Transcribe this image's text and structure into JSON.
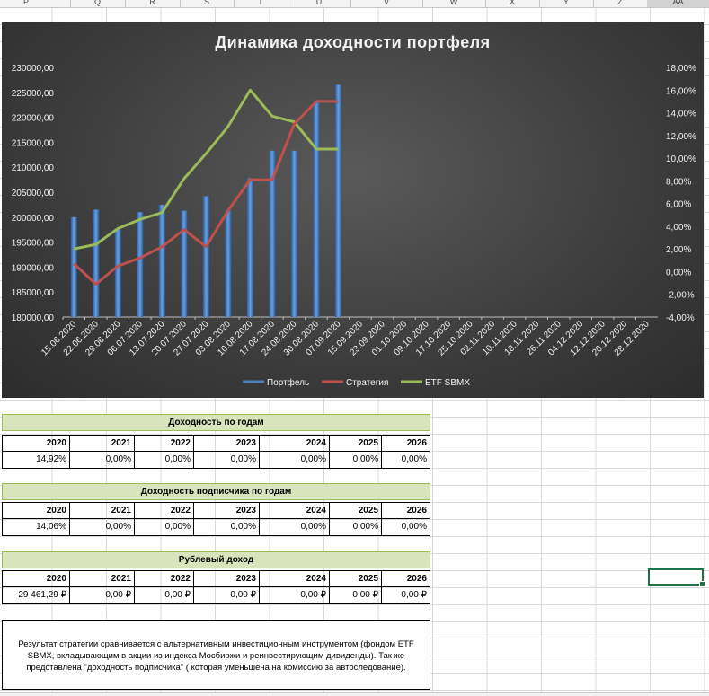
{
  "columns": [
    "P",
    "Q",
    "R",
    "S",
    "T",
    "U",
    "V",
    "W",
    "X",
    "Y",
    "Z",
    "AA"
  ],
  "chart_data": {
    "type": "bar",
    "title": "Динамика доходности портфеля",
    "categories": [
      "15.06.2020",
      "22.06.2020",
      "29.06.2020",
      "06.07.2020",
      "13.07.2020",
      "20.07.2020",
      "27.07.2020",
      "03.08.2020",
      "10.08.2020",
      "17.08.2020",
      "24.08.2020",
      "30.08.2020",
      "07.09.2020",
      "15.09.2020",
      "23.09.2020",
      "01.10.2020",
      "09.10.2020",
      "17.10.2020",
      "25.10.2020",
      "02.11.2020",
      "10.11.2020",
      "18.11.2020",
      "26.11.2020",
      "04.12.2020",
      "12.12.2020",
      "20.12.2020",
      "28.12.2020"
    ],
    "y_left_ticks": [
      "180000,00",
      "185000,00",
      "190000,00",
      "195000,00",
      "200000,00",
      "205000,00",
      "210000,00",
      "215000,00",
      "220000,00",
      "225000,00",
      "230000,00"
    ],
    "y_right_ticks": [
      "-4,00%",
      "-2,00%",
      "0,00%",
      "2,00%",
      "4,00%",
      "6,00%",
      "8,00%",
      "10,00%",
      "12,00%",
      "14,00%",
      "16,00%",
      "18,00%"
    ],
    "ylim_left": [
      180000,
      230000
    ],
    "ylim_right": [
      -4,
      18
    ],
    "series": [
      {
        "name": "Портфель",
        "type": "bar",
        "axis": "left",
        "color": "#4f81bd",
        "values": [
          200000,
          201500,
          197500,
          201000,
          202500,
          201300,
          204200,
          201300,
          207800,
          213300,
          213300,
          223000,
          226500
        ]
      },
      {
        "name": "Стратегия",
        "type": "line",
        "axis": "right",
        "color": "#c0504d",
        "values": [
          0.7,
          -1.1,
          0.5,
          1.2,
          2.2,
          3.7,
          2.2,
          5.4,
          8.1,
          8.1,
          13.0,
          15.0,
          15.0
        ]
      },
      {
        "name": "ETF SBMX",
        "type": "line",
        "axis": "right",
        "color": "#9bbb59",
        "values": [
          2.0,
          2.4,
          3.8,
          4.6,
          5.2,
          8.2,
          10.4,
          12.8,
          16.0,
          13.7,
          13.2,
          10.8,
          10.8
        ]
      }
    ],
    "legend_position": "bottom",
    "grid": false
  },
  "tables": [
    {
      "title": "Доходность по годам",
      "years": [
        "2020",
        "2021",
        "2022",
        "2023",
        "2024",
        "2025",
        "2026"
      ],
      "values": [
        "14,92%",
        "0,00%",
        "0,00%",
        "0,00%",
        "0,00%",
        "0,00%",
        "0,00%"
      ]
    },
    {
      "title": "Доходность подписчика по годам",
      "years": [
        "2020",
        "2021",
        "2022",
        "2023",
        "2024",
        "2025",
        "2026"
      ],
      "values": [
        "14,06%",
        "0,00%",
        "0,00%",
        "0,00%",
        "0,00%",
        "0,00%",
        "0,00%"
      ]
    },
    {
      "title": "Рублевый доход",
      "years": [
        "2020",
        "2021",
        "2022",
        "2023",
        "2024",
        "2025",
        "2026"
      ],
      "values": [
        "29 461,29 ₽",
        "0,00 ₽",
        "0,00 ₽",
        "0,00 ₽",
        "0,00 ₽",
        "0,00 ₽",
        "0,00 ₽"
      ]
    }
  ],
  "note": {
    "line1": "Результат стратегии сравнивается с альтернативным инвестиционным инструментом (фондом ETF",
    "line2": "SBMX, вкладывающим в акции из индекса Мосбиржи и реинвестирующим дивиденды). Так же",
    "line3": "представлена \"доходность подписчика\" ( которая уменьшена на комиссию за автоследование)."
  }
}
